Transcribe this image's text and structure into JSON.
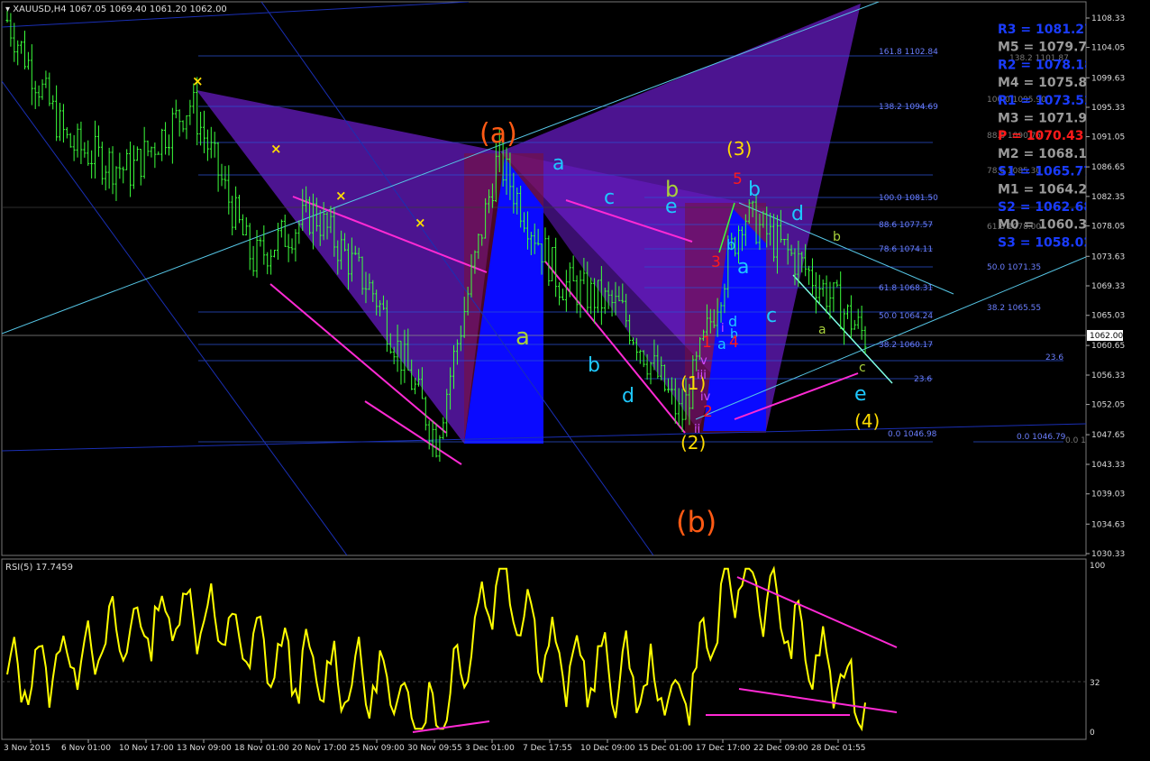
{
  "header": {
    "symbol": "XAUUSD,H4",
    "ohlc": "1067.05 1069.40 1061.20 1062.00"
  },
  "rsi": {
    "label": "RSI(5) 17.7459",
    "axis": [
      "100",
      "32",
      "0"
    ]
  },
  "price_axis": [
    "1108.33",
    "1104.05",
    "1099.63",
    "1095.33",
    "1091.05",
    "1086.65",
    "1082.35",
    "1078.05",
    "1073.63",
    "1069.33",
    "1065.03",
    "1060.65",
    "1056.33",
    "1052.05",
    "1047.65",
    "1043.33",
    "1039.03",
    "1034.63",
    "1030.33"
  ],
  "current_price": "1062.00",
  "time_axis": [
    "3 Nov 2015",
    "6 Nov 01:00",
    "10 Nov 17:00",
    "13 Nov 09:00",
    "18 Nov 01:00",
    "20 Nov 17:00",
    "25 Nov 09:00",
    "30 Nov 09:55",
    "3 Dec 01:00",
    "7 Dec 17:55",
    "10 Dec 09:00",
    "15 Dec 01:00",
    "17 Dec 17:00",
    "22 Dec 09:00",
    "28 Dec 01:55"
  ],
  "pivots": [
    {
      "text": "R3 = 1081.27",
      "color": "#1a3cff"
    },
    {
      "text": "M5 = 1079.72",
      "color": "#9a9a9a"
    },
    {
      "text": "R2 = 1078.18",
      "color": "#1a3cff"
    },
    {
      "text": "M4 = 1075.85",
      "color": "#9a9a9a"
    },
    {
      "text": "R1 = 1073.52",
      "color": "#1a3cff"
    },
    {
      "text": "M3 = 1071.97",
      "color": "#9a9a9a"
    },
    {
      "text": "P = 1070.43",
      "color": "#ff1a1a"
    },
    {
      "text": "M2 = 1068.10",
      "color": "#9a9a9a"
    },
    {
      "text": "S1 = 1065.77",
      "color": "#1a3cff"
    },
    {
      "text": "M1 = 1064.22",
      "color": "#9a9a9a"
    },
    {
      "text": "S2 = 1062.68",
      "color": "#1a3cff"
    },
    {
      "text": "M0 = 1060.35",
      "color": "#9a9a9a"
    },
    {
      "text": "S3 = 1058.02",
      "color": "#1a3cff"
    }
  ],
  "fib_labels": {
    "f1618": "161.8 1102.84",
    "f1382a": "138.2 1101.87",
    "f1382": "138.2 1094.69",
    "f100b": "100.0 1095.90",
    "f886b": "88.6 1090.75",
    "f786b": "78.6 1085.30",
    "f100": "100.0 1081.50",
    "f886": "88.6 1077.57",
    "f786": "78.6 1074.11",
    "f618b": "61.8 1078.00",
    "f500": "50.0 1071.35",
    "f618": "61.8 1068.31",
    "f500b": "50.0 1064.24",
    "f382": "38.2 1065.55",
    "f382b": "38.2 1060.17",
    "f236": "23.6",
    "f236b": "23.6",
    "f236c": "23.6",
    "f00a": "0.0 1046.98",
    "f00b": "0.0 1046.79",
    "f00c": "0.0 1046.27"
  },
  "waves": {
    "a_big": "(a)",
    "b_big": "(b)",
    "w3": "(3)",
    "w4": "(4)",
    "w1": "(1)",
    "w2": "(2)",
    "a1": "a",
    "c1": "c",
    "e1": "e",
    "b1": "b",
    "b2": "b",
    "d1": "d",
    "b3": "b",
    "a2": "a",
    "c2": "c",
    "d2": "d",
    "b4": "b",
    "a3": "a",
    "c3": "c",
    "e2": "e",
    "a4": "a",
    "a5": "a",
    "b5": "b",
    "c4": "c",
    "d3": "d",
    "b6": "b",
    "n5": "5",
    "n3": "3",
    "n1": "1",
    "n2": "2",
    "n4": "4",
    "ii": "ii",
    "v": "v",
    "iv": "iv",
    "iii": "iii",
    "i": "i"
  },
  "colors": {
    "background": "#000000",
    "candle": "#3cff3c",
    "harmonic": "#7a1fd6",
    "fill_blue": "#0a0aff",
    "magenta": "#ff2ad4",
    "rsi_line": "#ffff00",
    "orange": "#ff5a14",
    "yellow": "#ffdc00",
    "cyan": "#1ec8ff"
  },
  "chart_data": {
    "type": "line",
    "title": "XAUUSD,H4",
    "x": [
      "3 Nov 2015",
      "6 Nov 01:00",
      "10 Nov 17:00",
      "13 Nov 09:00",
      "18 Nov 01:00",
      "20 Nov 17:00",
      "25 Nov 09:00",
      "30 Nov 09:55",
      "3 Dec 01:00",
      "7 Dec 17:55",
      "10 Dec 09:00",
      "15 Dec 01:00",
      "17 Dec 17:00",
      "22 Dec 09:00",
      "28 Dec 01:55"
    ],
    "series": [
      {
        "name": "XAUUSD,H4",
        "values": [
          1108,
          1090,
          1086,
          1096,
          1073,
          1080,
          1068,
          1047,
          1088,
          1070,
          1066,
          1050,
          1080,
          1072,
          1062
        ]
      },
      {
        "name": "RSI(5)",
        "values": [
          30,
          45,
          60,
          75,
          50,
          35,
          30,
          5,
          95,
          40,
          35,
          20,
          100,
          50,
          17.7459
        ]
      }
    ],
    "ylim": [
      1030.33,
      1108.33
    ],
    "rsi_ylim": [
      0,
      100
    ]
  }
}
